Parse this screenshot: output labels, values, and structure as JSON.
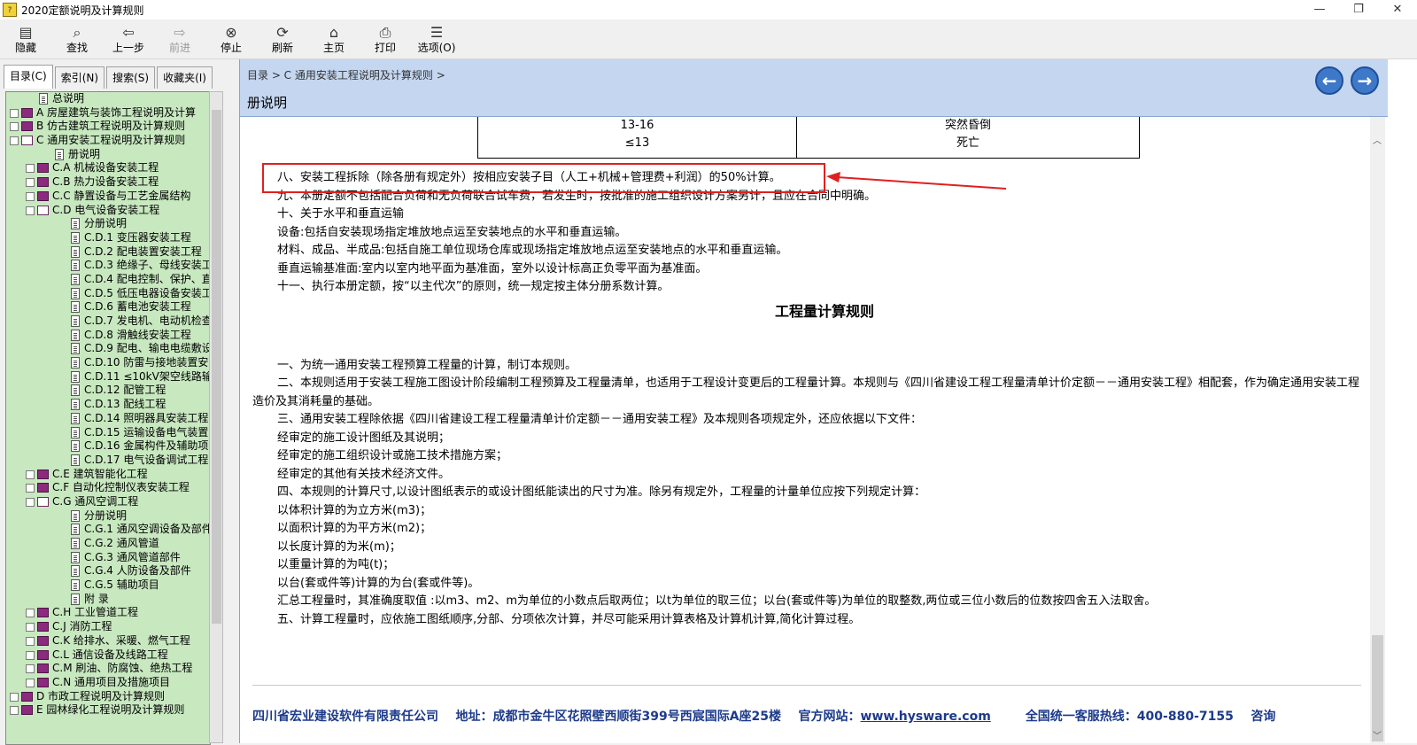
{
  "window": {
    "title": "2020定额说明及计算规则"
  },
  "toolbar": {
    "buttons": [
      {
        "label": "隐藏",
        "icon": "hide-icon",
        "glyph": "▤"
      },
      {
        "label": "查找",
        "icon": "find-icon",
        "glyph": "⌕"
      },
      {
        "label": "上一步",
        "icon": "back-icon",
        "glyph": "⇦"
      },
      {
        "label": "前进",
        "icon": "forward-icon",
        "glyph": "⇨"
      },
      {
        "label": "停止",
        "icon": "stop-icon",
        "glyph": "⊗"
      },
      {
        "label": "刷新",
        "icon": "refresh-icon",
        "glyph": "⟳"
      },
      {
        "label": "主页",
        "icon": "home-icon",
        "glyph": "⌂"
      },
      {
        "label": "打印",
        "icon": "print-icon",
        "glyph": "⎙"
      },
      {
        "label": "选项(O)",
        "icon": "options-icon",
        "glyph": "☰"
      }
    ]
  },
  "tabs": [
    "目录(C)",
    "索引(N)",
    "搜索(S)",
    "收藏夹(I)"
  ],
  "tree": [
    {
      "label": "总说明",
      "level": 1,
      "type": "page"
    },
    {
      "label": "A 房屋建筑与装饰工程说明及计算",
      "level": 0,
      "type": "book",
      "expander": "+"
    },
    {
      "label": "B 仿古建筑工程说明及计算规则",
      "level": 0,
      "type": "book",
      "expander": "+"
    },
    {
      "label": "C 通用安装工程说明及计算规则",
      "level": 0,
      "type": "book-open",
      "expander": "-"
    },
    {
      "label": "册说明",
      "level": 2,
      "type": "page"
    },
    {
      "label": "C.A 机械设备安装工程",
      "level": 1,
      "type": "book",
      "expander": "+"
    },
    {
      "label": "C.B 热力设备安装工程",
      "level": 1,
      "type": "book",
      "expander": "+"
    },
    {
      "label": "C.C 静置设备与工艺金属结构",
      "level": 1,
      "type": "book",
      "expander": "+"
    },
    {
      "label": "C.D 电气设备安装工程",
      "level": 1,
      "type": "book-open",
      "expander": "-"
    },
    {
      "label": "分册说明",
      "level": 3,
      "type": "page"
    },
    {
      "label": "C.D.1 变压器安装工程",
      "level": 3,
      "type": "page"
    },
    {
      "label": "C.D.2 配电装置安装工程",
      "level": 3,
      "type": "page"
    },
    {
      "label": "C.D.3 绝缘子、母线安装工",
      "level": 3,
      "type": "page"
    },
    {
      "label": "C.D.4 配电控制、保护、直",
      "level": 3,
      "type": "page"
    },
    {
      "label": "C.D.5 低压电器设备安装工",
      "level": 3,
      "type": "page"
    },
    {
      "label": "C.D.6 蓄电池安装工程",
      "level": 3,
      "type": "page"
    },
    {
      "label": "C.D.7 发电机、电动机检查",
      "level": 3,
      "type": "page"
    },
    {
      "label": "C.D.8 滑触线安装工程",
      "level": 3,
      "type": "page"
    },
    {
      "label": "C.D.9 配电、输电电缆敷设",
      "level": 3,
      "type": "page"
    },
    {
      "label": "C.D.10 防雷与接地装置安",
      "level": 3,
      "type": "page"
    },
    {
      "label": "C.D.11 ≤10kV架空线路输",
      "level": 3,
      "type": "page"
    },
    {
      "label": "C.D.12 配管工程",
      "level": 3,
      "type": "page"
    },
    {
      "label": "C.D.13 配线工程",
      "level": 3,
      "type": "page"
    },
    {
      "label": "C.D.14 照明器具安装工程",
      "level": 3,
      "type": "page"
    },
    {
      "label": "C.D.15 运输设备电气装置",
      "level": 3,
      "type": "page"
    },
    {
      "label": "C.D.16 金属构件及辅助项",
      "level": 3,
      "type": "page"
    },
    {
      "label": "C.D.17 电气设备调试工程",
      "level": 3,
      "type": "page"
    },
    {
      "label": "C.E 建筑智能化工程",
      "level": 1,
      "type": "book",
      "expander": "+"
    },
    {
      "label": "C.F 自动化控制仪表安装工程",
      "level": 1,
      "type": "book",
      "expander": "+"
    },
    {
      "label": "C.G 通风空调工程",
      "level": 1,
      "type": "book-open",
      "expander": "-"
    },
    {
      "label": "分册说明",
      "level": 3,
      "type": "page"
    },
    {
      "label": "C.G.1 通风空调设备及部件",
      "level": 3,
      "type": "page"
    },
    {
      "label": "C.G.2 通风管道",
      "level": 3,
      "type": "page"
    },
    {
      "label": "C.G.3 通风管道部件",
      "level": 3,
      "type": "page"
    },
    {
      "label": "C.G.4 人防设备及部件",
      "level": 3,
      "type": "page"
    },
    {
      "label": "C.G.5 辅助项目",
      "level": 3,
      "type": "page"
    },
    {
      "label": "附 录",
      "level": 3,
      "type": "page"
    },
    {
      "label": "C.H 工业管道工程",
      "level": 1,
      "type": "book",
      "expander": "+"
    },
    {
      "label": "C.J 消防工程",
      "level": 1,
      "type": "book",
      "expander": "+"
    },
    {
      "label": "C.K 给排水、采暖、燃气工程",
      "level": 1,
      "type": "book",
      "expander": "+"
    },
    {
      "label": "C.L 通信设备及线路工程",
      "level": 1,
      "type": "book",
      "expander": "+"
    },
    {
      "label": "C.M 刷油、防腐蚀、绝热工程",
      "level": 1,
      "type": "book",
      "expander": "+"
    },
    {
      "label": "C.N 通用项目及措施项目",
      "level": 1,
      "type": "book",
      "expander": "+"
    },
    {
      "label": "D 市政工程说明及计算规则",
      "level": 0,
      "type": "book",
      "expander": "+"
    },
    {
      "label": "E 园林绿化工程说明及计算规则",
      "level": 0,
      "type": "book",
      "expander": "+"
    }
  ],
  "header": {
    "breadcrumb": "目录 > C 通用安装工程说明及计算规则 >",
    "title": "册说明",
    "back_glyph": "←",
    "forward_glyph": "→"
  },
  "table": {
    "left": [
      "13-16",
      "≤13"
    ],
    "right": [
      "突然昏倒",
      "死亡"
    ]
  },
  "paragraphs": [
    "八、安装工程拆除（除各册有规定外）按相应安装子目（人工+机械+管理费+利润）的50%计算。",
    "九、本册定额不包括配合负荷和无负荷联合试车费，若发生时，按批准的施工组织设计方案另计，且应在合同中明确。",
    "十、关于水平和垂直运输",
    "设备:包括自安装现场指定堆放地点运至安装地点的水平和垂直运输。",
    "材料、成品、半成品:包括自施工单位现场仓库或现场指定堆放地点运至安装地点的水平和垂直运输。",
    "垂直运输基准面:室内以室内地平面为基准面，室外以设计标高正负零平面为基准面。",
    "十一、执行本册定额，按“以主代次”的原则，统一规定按主体分册系数计算。"
  ],
  "rules_title": "工程量计算规则",
  "rules": [
    "一、为统一通用安装工程预算工程量的计算，制订本规则。",
    "二、本规则适用于安装工程施工图设计阶段编制工程预算及工程量清单，也适用于工程设计变更后的工程量计算。本规则与《四川省建设工程工程量清单计价定额－－通用安装工程》相配套，作为确定通用安装工程造价及其消耗量的基础。",
    "三、通用安装工程除依据《四川省建设工程工程量清单计价定额－－通用安装工程》及本规则各项规定外，还应依据以下文件：",
    "经审定的施工设计图纸及其说明；",
    "经审定的施工组织设计或施工技术措施方案；",
    "经审定的其他有关技术经济文件。",
    "四、本规则的计算尺寸,以设计图纸表示的或设计图纸能读出的尺寸为准。除另有规定外，工程量的计量单位应按下列规定计算：",
    "以体积计算的为立方米(m3)；",
    "以面积计算的为平方米(m2)；",
    "以长度计算的为米(m)；",
    "以重量计算的为吨(t)；",
    "以台(套或件等)计算的为台(套或件等)。",
    "汇总工程量时，其准确度取值 :以m3、m2、m为单位的小数点后取两位；以t为单位的取三位；以台(套或件等)为单位的取整数,两位或三位小数后的位数按四舍五入法取舍。",
    "五、计算工程量时，应依施工图纸顺序,分部、分项依次计算，并尽可能采用计算表格及计算机计算,简化计算过程。"
  ],
  "footer": {
    "company": "四川省宏业建设软件有限责任公司",
    "address": "地址：成都市金牛区花照壁西顺街399号西宸国际A座25楼",
    "website_label": "官方网站：",
    "website": "www.hysware.com",
    "hotline": "全国统一客服热线：400-880-7155",
    "consult": "咨询"
  },
  "colors": {
    "highlight": "#e02020",
    "tree_bg": "#c8e8c0",
    "header_bg": "#c4d6f0"
  }
}
